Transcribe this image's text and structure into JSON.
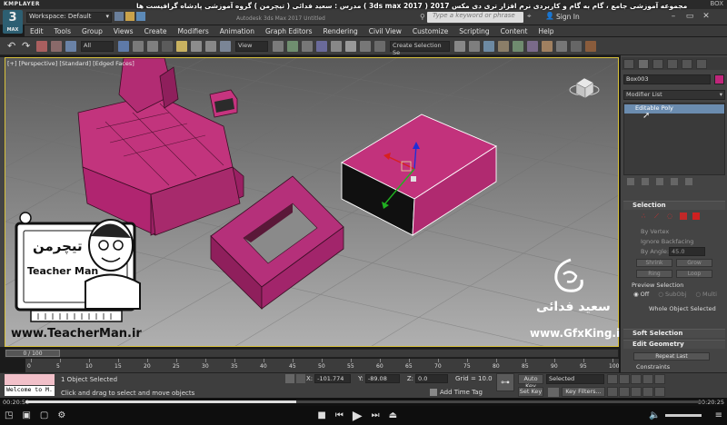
{
  "player": {
    "brand": "KMPLAYER",
    "right_label": "BOX",
    "elapsed": "00:20:50",
    "total": "00:20:25",
    "progress": 0.4
  },
  "caption": "مجموعه آموزشی جامع ، گام به گام و کاربردی نرم افزار تری دی مکس 2017 ( 3ds max 2017 ) مدرس : سعید فدائی ( تیچرمن ) گروه آموزشی پادشاه گرافیست ها",
  "app": {
    "logo": "3",
    "logo_sub": "MAX",
    "workspace": "Workspace: Default",
    "window_title": "Autodesk 3ds Max 2017     Untitled",
    "search_placeholder": "Type a keyword or phrase",
    "sign_in": "Sign In"
  },
  "menu": [
    "Edit",
    "Tools",
    "Group",
    "Views",
    "Create",
    "Modifiers",
    "Animation",
    "Graph Editors",
    "Rendering",
    "Civil View",
    "Customize",
    "Scripting",
    "Content",
    "Help"
  ],
  "toolbar": {
    "filter": "All",
    "ref_coord": "View",
    "selection_set": "Create Selection Se"
  },
  "viewport": {
    "label": "[+] [Perspective] [Standard] [Edged Faces]"
  },
  "command_panel": {
    "object_name": "Box003",
    "object_color": "#c0267b",
    "modifier_list": "Modifier List",
    "stack_item": "Editable Poly",
    "selection": {
      "title": "Selection",
      "by_vertex": "By Vertex",
      "ignore_backfacing": "Ignore Backfacing",
      "by_angle": "By Angle:",
      "angle_value": "45.0",
      "shrink": "Shrink",
      "grow": "Grow",
      "ring": "Ring",
      "loop": "Loop",
      "preview": "Preview Selection",
      "off": "Off",
      "subobj": "SubObj",
      "multi": "Multi",
      "summary": "Whole Object Selected"
    },
    "soft_selection": "Soft Selection",
    "edit_geometry": "Edit Geometry",
    "repeat_last": "Repeat Last",
    "constraints": "Constraints"
  },
  "timeline": {
    "slider": "0 / 100",
    "ticks": [
      "0",
      "5",
      "10",
      "15",
      "20",
      "25",
      "30",
      "35",
      "40",
      "45",
      "50",
      "55",
      "60",
      "65",
      "70",
      "75",
      "80",
      "85",
      "90",
      "95",
      "100"
    ]
  },
  "status": {
    "welcome": "Welcome to M.",
    "selected": "1 Object Selected",
    "prompt": "Click and drag to select and move objects",
    "x_label": "X:",
    "x": "-101.774",
    "y_label": "Y:",
    "y": "-89.08",
    "z_label": "Z:",
    "z": "0.0",
    "grid": "Grid = 10.0",
    "add_time_tag": "Add Time Tag",
    "auto_key": "Auto Key",
    "set_key": "Set Key",
    "selected_dd": "Selected",
    "key_filters": "Key Filters..."
  },
  "watermark": {
    "teacher_title": "تیچرمن",
    "teacher_name": "Teacher Man",
    "teacher_url": "www.TeacherMan.ir",
    "gfx_name": "سعید فدائی",
    "gfx_url": "www.GfxKing.ir"
  }
}
